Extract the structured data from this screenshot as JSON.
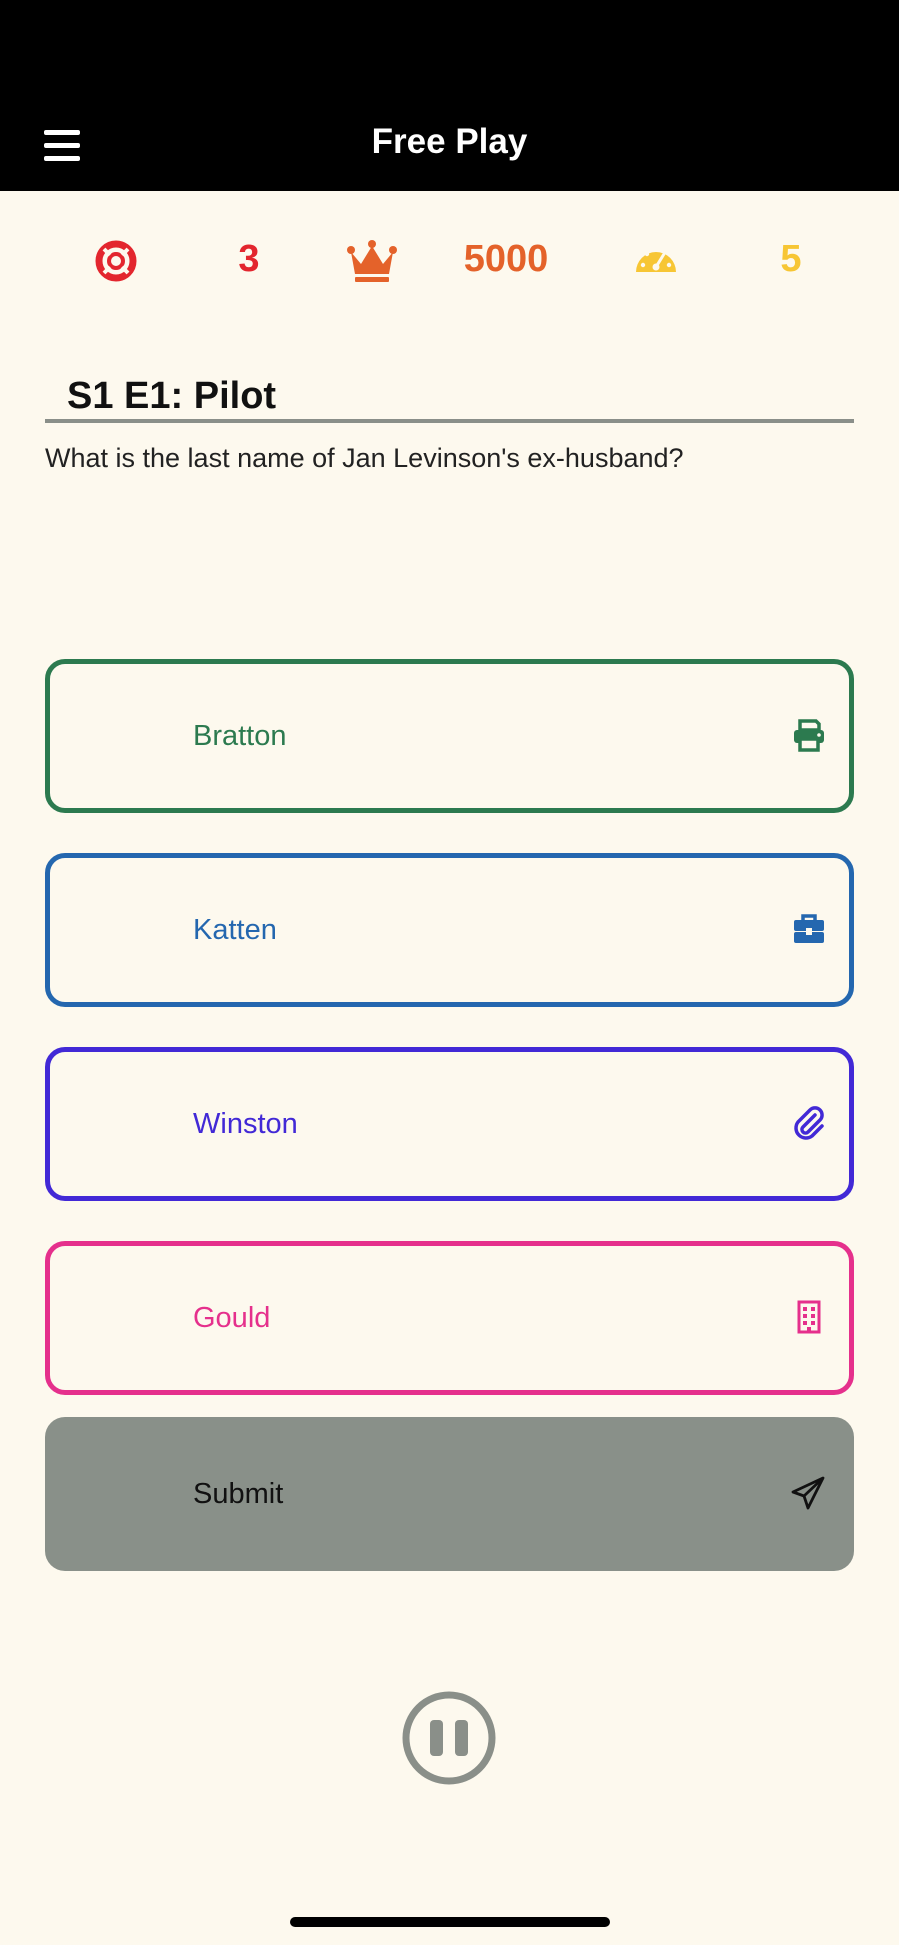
{
  "header": {
    "title": "Free Play",
    "menu_icon": "hamburger-menu-icon"
  },
  "stats": {
    "lifelines": {
      "icon": "lifebuoy-icon",
      "value": "3",
      "color": "#E3262E"
    },
    "high_score": {
      "icon": "crown-icon",
      "value": "5000",
      "color": "#E4622A"
    },
    "speed": {
      "icon": "speedometer-icon",
      "value": "5",
      "color": "#F7C634"
    }
  },
  "episode": {
    "title": "S1 E1: Pilot"
  },
  "question": {
    "text": "What is the last name of Jan Levinson's ex-husband?"
  },
  "answers": [
    {
      "label": "Bratton",
      "icon": "printer-icon",
      "color": "#2C7A4F"
    },
    {
      "label": "Katten",
      "icon": "briefcase-icon",
      "color": "#2467AF"
    },
    {
      "label": "Winston",
      "icon": "paperclip-icon",
      "color": "#4229D6"
    },
    {
      "label": "Gould",
      "icon": "building-icon",
      "color": "#E5308C"
    }
  ],
  "submit": {
    "label": "Submit",
    "icon": "send-icon",
    "bg_color": "#899089"
  },
  "pause": {
    "icon": "pause-icon",
    "color": "#8A8F89"
  },
  "colors": {
    "background": "#FDF9EE",
    "header_bg": "#000000"
  }
}
